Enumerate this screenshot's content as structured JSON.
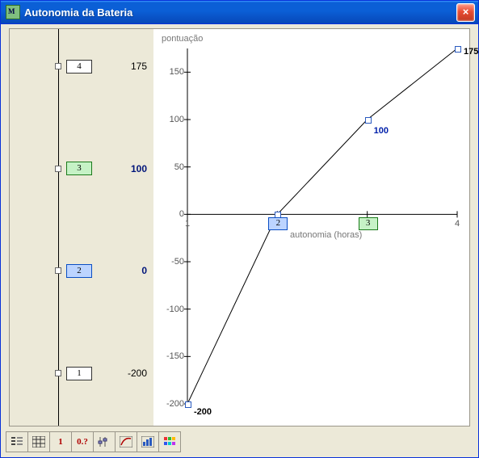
{
  "window": {
    "title": "Autonomia da Bateria",
    "close_label": "×"
  },
  "scale_items": [
    {
      "cat": "4",
      "value": "175",
      "style": "plain",
      "box": "plain"
    },
    {
      "cat": "3",
      "value": "100",
      "style": "bold",
      "box": "good"
    },
    {
      "cat": "2",
      "value": "0",
      "style": "bold",
      "box": "sel"
    },
    {
      "cat": "1",
      "value": "-200",
      "style": "plain",
      "box": "plain"
    }
  ],
  "chart_data": {
    "type": "line",
    "title": "",
    "xlabel": "autonomia (horas)",
    "ylabel": "pontuação",
    "xlim": [
      1,
      4
    ],
    "ylim": [
      -200,
      175
    ],
    "x_ticks": [
      1,
      2,
      3,
      4
    ],
    "y_ticks": [
      -200,
      -150,
      -100,
      -50,
      0,
      50,
      100,
      150
    ],
    "x": [
      1,
      2,
      3,
      4
    ],
    "values": [
      -200,
      0,
      100,
      175
    ],
    "data_labels": {
      "1": "-200",
      "3": "100",
      "4": "175"
    },
    "x_category_boxes": [
      {
        "x": 2,
        "label": "2",
        "style": "sel"
      },
      {
        "x": 3,
        "label": "3",
        "style": "good"
      }
    ]
  },
  "toolbar": {
    "btn_scale_label": "1",
    "btn_precision_label": "0.?"
  }
}
